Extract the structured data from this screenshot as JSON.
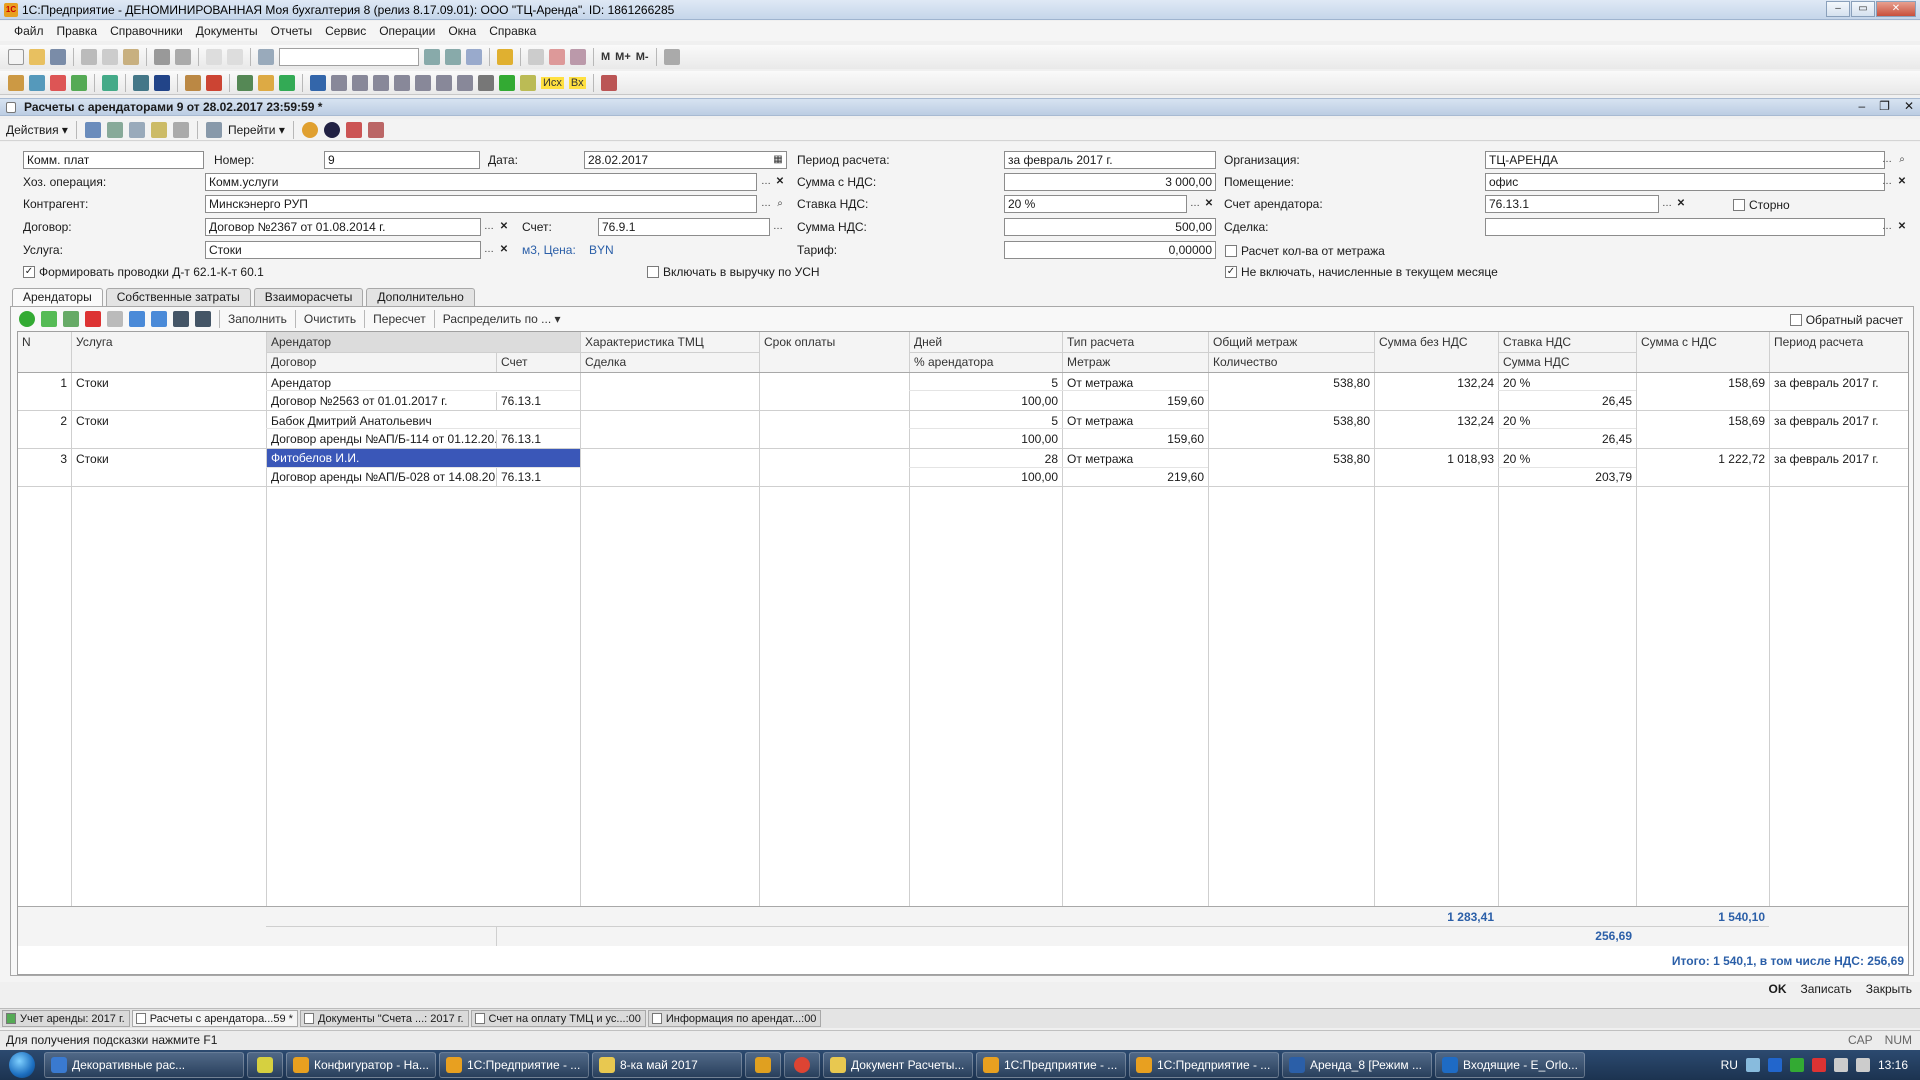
{
  "window": {
    "title": "1С:Предприятие - ДЕНОМИНИРОВАННАЯ Моя бухгалтерия 8 (релиз 8.17.09.01): ООО \"ТЦ-Аренда\". ID: 1861266285"
  },
  "menu": [
    "Файл",
    "Правка",
    "Справочники",
    "Документы",
    "Отчеты",
    "Сервис",
    "Операции",
    "Окна",
    "Справка"
  ],
  "toolbar": {
    "m": "М",
    "mplus": "М+",
    "mminus": "М-",
    "ish": "Исх",
    "vh": "Вх"
  },
  "document": {
    "title": "Расчеты с арендаторами 9 от 28.02.2017 23:59:59 *"
  },
  "actions": {
    "actions_label": "Действия",
    "goto_label": "Перейти"
  },
  "form": {
    "comm_plat": "Комм. плат",
    "number_label": "Номер:",
    "number": "9",
    "date_label": "Дата:",
    "date": "28.02.2017",
    "period_label": "Период расчета:",
    "period": "за февраль 2017 г.",
    "org_label": "Организация:",
    "org": "ТЦ-АРЕНДА",
    "hoz_label": "Хоз. операция:",
    "hoz": "Комм.услуги",
    "sum_vat_label": "Сумма с НДС:",
    "sum_vat": "3 000,00",
    "room_label": "Помещение:",
    "room": "офис",
    "counterparty_label": "Контрагент:",
    "counterparty": "Минскэнерго РУП",
    "vat_rate_label": "Ставка НДС:",
    "vat_rate": "20 %",
    "tenant_account_label": "Счет арендатора:",
    "tenant_account": "76.13.1",
    "storno_label": "Сторно",
    "contract_label": "Договор:",
    "contract": "Договор №2367 от 01.08.2014 г.",
    "account_label": "Счет:",
    "account": "76.9.1",
    "vat_sum_label": "Сумма НДС:",
    "vat_sum": "500,00",
    "deal_label": "Сделка:",
    "deal": "",
    "service_label": "Услуга:",
    "service": "Стоки",
    "unit_price": "м3, Цена:",
    "currency": "BYN",
    "tariff_label": "Тариф:",
    "tariff": "0,00000",
    "calc_by_area": "Расчет кол-ва от метража",
    "form_entries": "Формировать проводки Д-т 62.1-К-т 60.1",
    "include_usn": "Включать в выручку по УСН",
    "exclude_current": "Не включать, начисленные в текущем месяце"
  },
  "tabs": [
    "Арендаторы",
    "Собственные затраты",
    "Взаиморасчеты",
    "Дополнительно"
  ],
  "grid_toolbar": {
    "fill": "Заполнить",
    "clear": "Очистить",
    "recalc": "Пересчет",
    "distribute": "Распределить по ...",
    "reverse": "Обратный расчет"
  },
  "grid": {
    "headers_top": [
      "N",
      "Услуга",
      "Арендатор",
      "Характеристика ТМЦ",
      "Срок оплаты",
      "Дней",
      "Тип расчета",
      "Общий метраж",
      "Сумма без НДС",
      "Ставка НДС",
      "Сумма с НДС",
      "Период расчета"
    ],
    "headers_bottom": [
      "Договор",
      "Счет",
      "Сделка",
      "% арендатора",
      "Метраж",
      "Количество",
      "Сумма НДС"
    ],
    "rows": [
      {
        "n": "1",
        "service": "Стоки",
        "tenant": "Арендатор",
        "contract": "Договор №2563 от 01.01.2017 г.",
        "account": "76.13.1",
        "days": "5",
        "percent": "100,00",
        "calc_type": "От метража",
        "area": "159,60",
        "total_area": "538,80",
        "sum_no_vat": "132,24",
        "vat_rate": "20 %",
        "vat_sum": "26,45",
        "sum_vat": "158,69",
        "period": "за февраль 2017 г."
      },
      {
        "n": "2",
        "service": "Стоки",
        "tenant": "Бабок Дмитрий Анатольевич",
        "contract": "Договор аренды №АП/Б-114 от 01.12.20...",
        "account": "76.13.1",
        "days": "5",
        "percent": "100,00",
        "calc_type": "От метража",
        "area": "159,60",
        "total_area": "538,80",
        "sum_no_vat": "132,24",
        "vat_rate": "20 %",
        "vat_sum": "26,45",
        "sum_vat": "158,69",
        "period": "за февраль 2017 г."
      },
      {
        "n": "3",
        "service": "Стоки",
        "tenant": "Фитобелов И.И.",
        "contract": "Договор аренды №АП/Б-028 от 14.08.20...",
        "account": "76.13.1",
        "days": "28",
        "percent": "100,00",
        "calc_type": "От метража",
        "area": "219,60",
        "total_area": "538,80",
        "sum_no_vat": "1 018,93",
        "vat_rate": "20 %",
        "vat_sum": "203,79",
        "sum_vat": "1 222,72",
        "period": "за февраль 2017 г."
      }
    ],
    "totals": {
      "sum_no_vat": "1 283,41",
      "sum_vat": "1 540,10",
      "vat_sum": "256,69"
    },
    "summary": "Итого: 1 540,1, в том числе НДС: 256,69"
  },
  "bottom_buttons": {
    "ok": "OK",
    "save": "Записать",
    "close": "Закрыть"
  },
  "window_tabs": [
    "Учет аренды: 2017 г.",
    "Расчеты с арендатора...59 *",
    "Документы \"Счета ...: 2017 г.",
    "Счет на оплату ТМЦ и ус...:00",
    "Информация по арендат...:00"
  ],
  "status": {
    "hint": "Для получения подсказки нажмите F1",
    "cap": "CAP",
    "num": "NUM"
  },
  "taskbar": {
    "items": [
      "Декоративные рас...",
      "",
      "Конфигуратор - На...",
      "1С:Предприятие - ...",
      "8-ка май 2017",
      "",
      "",
      "Документ Расчеты...",
      "1С:Предприятие - ...",
      "1С:Предприятие - ...",
      "Аренда_8 [Режим ...",
      "Входящие - E_Orlo..."
    ],
    "lang": "RU",
    "time": "13:16"
  },
  "colors": {
    "selection": "#3a57b8",
    "total": "#2b5fa8",
    "titlebar": "#c5d6ea"
  }
}
